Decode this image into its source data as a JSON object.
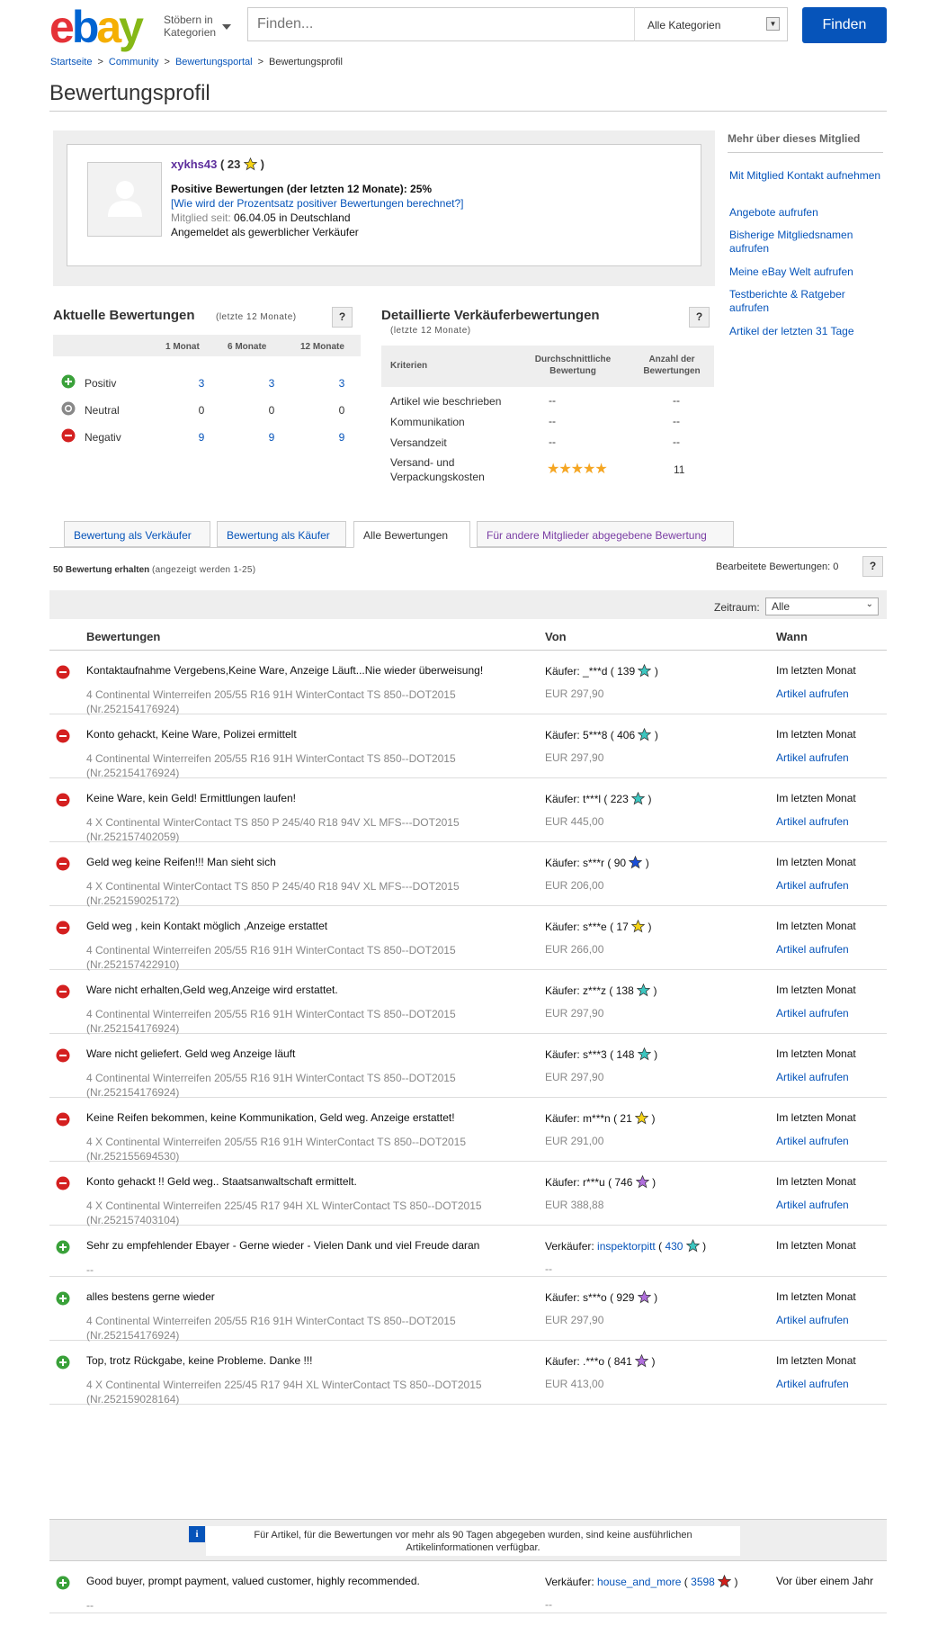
{
  "header": {
    "logo": [
      "e",
      "b",
      "a",
      "y"
    ],
    "browse_line1": "Stöbern in",
    "browse_line2": "Kategorien",
    "search_placeholder": "Finden...",
    "category": "Alle Kategorien",
    "find_button": "Finden"
  },
  "breadcrumb": [
    "Startseite",
    "Community",
    "Bewertungsportal",
    "Bewertungsprofil"
  ],
  "page_title": "Bewertungsprofil",
  "profile": {
    "username": "xykhs43",
    "score": "23",
    "positive": "Positive Bewertungen (der letzten 12 Monate): 25%",
    "how_calc": "[Wie wird der Prozentsatz positiver Bewertungen berechnet?]",
    "member_since_label": "Mitglied seit:",
    "member_since_date": "06.04.05",
    "member_since_country": "in Deutschland",
    "seller_type": "Angemeldet als gewerblicher Verkäufer"
  },
  "sidebar": {
    "heading": "Mehr über dieses Mitglied",
    "links": [
      "Mit Mitglied Kontakt aufnehmen",
      "Angebote aufrufen",
      "Bisherige Mitgliedsnamen aufrufen",
      "Meine eBay Welt aufrufen",
      "Testberichte & Ratgeber aufrufen",
      "Artikel der letzten 31 Tage"
    ]
  },
  "recent": {
    "title": "Aktuelle Bewertungen",
    "subtitle": "(letzte 12 Monate)",
    "help": "?",
    "cols": [
      "1 Monat",
      "6 Monate",
      "12 Monate"
    ],
    "rows": [
      {
        "label": "Positiv",
        "values": [
          "3",
          "3",
          "3"
        ]
      },
      {
        "label": "Neutral",
        "values": [
          "0",
          "0",
          "0"
        ]
      },
      {
        "label": "Negativ",
        "values": [
          "9",
          "9",
          "9"
        ]
      }
    ]
  },
  "dsr": {
    "title": "Detaillierte Verkäuferbewertungen",
    "subtitle": "(letzte 12 Monate)",
    "help": "?",
    "col_criteria": "Kriterien",
    "col_avg_1": "Durchschnittliche",
    "col_avg_2": "Bewertung",
    "col_count_1": "Anzahl der",
    "col_count_2": "Bewertungen",
    "rows": [
      {
        "label": "Artikel wie beschrieben",
        "avg": "--",
        "count": "--"
      },
      {
        "label": "Kommunikation",
        "avg": "--",
        "count": "--"
      },
      {
        "label": "Versandzeit",
        "avg": "--",
        "count": "--"
      },
      {
        "label": "Versand- und Verpackungskosten",
        "stars": 5,
        "count": "11"
      }
    ]
  },
  "tabs": [
    "Bewertung als Verkäufer",
    "Bewertung als Käufer",
    "Alle Bewertungen",
    "Für andere Mitglieder abgegebene Bewertung"
  ],
  "list_info": {
    "count_bold": "50 Bewertung erhalten",
    "count_rest": "(angezeigt werden 1-25)",
    "edited": "Bearbeitete Bewertungen: 0",
    "help": "?",
    "period_label": "Zeitraum:",
    "period_value": "Alle"
  },
  "columns": [
    "Bewertungen",
    "Von",
    "Wann"
  ],
  "colors": {
    "star_yellow": "#f5d316",
    "star_turquoise": "#3cc6c0",
    "star_blue": "#1b4fd8",
    "star_purple": "#b06fdc",
    "star_red": "#d4201b",
    "negative": "#d42020",
    "positive": "#3aa13a"
  },
  "feedback": [
    {
      "type": "negative",
      "comment": "Kontaktaufnahme Vergebens,Keine Ware, Anzeige Läuft...Nie wieder überweisung!",
      "item_line1": "4 Continental Winterreifen 205/55 R16 91H WinterContact TS 850--DOT2015",
      "item_line2": "(Nr.252154176924)",
      "from_role": "Käufer:",
      "from_name": "_***d",
      "from_score": "139",
      "star": "turquoise",
      "price": "EUR 297,90",
      "when": "Im letzten Monat",
      "view": "Artikel aufrufen"
    },
    {
      "type": "negative",
      "comment": "Konto gehackt, Keine Ware, Polizei ermittelt",
      "item_line1": "4 Continental Winterreifen 205/55 R16 91H WinterContact TS 850--DOT2015",
      "item_line2": "(Nr.252154176924)",
      "from_role": "Käufer:",
      "from_name": "5***8",
      "from_score": "406",
      "star": "turquoise",
      "price": "EUR 297,90",
      "when": "Im letzten Monat",
      "view": "Artikel aufrufen"
    },
    {
      "type": "negative",
      "comment": "Keine Ware, kein Geld! Ermittlungen laufen!",
      "item_line1": "4 X Continental WinterContact TS 850 P 245/40 R18 94V XL MFS---DOT2015",
      "item_line2": "(Nr.252157402059)",
      "from_role": "Käufer:",
      "from_name": "t***l",
      "from_score": "223",
      "star": "turquoise",
      "price": "EUR 445,00",
      "when": "Im letzten Monat",
      "view": "Artikel aufrufen"
    },
    {
      "type": "negative",
      "comment": "Geld weg keine Reifen!!! Man sieht sich",
      "item_line1": "4 X Continental WinterContact TS 850 P 245/40 R18 94V XL MFS---DOT2015",
      "item_line2": "(Nr.252159025172)",
      "from_role": "Käufer:",
      "from_name": "s***r",
      "from_score": "90",
      "star": "blue",
      "price": "EUR 206,00",
      "when": "Im letzten Monat",
      "view": "Artikel aufrufen"
    },
    {
      "type": "negative",
      "comment": "Geld weg , kein Kontakt möglich ,Anzeige erstattet",
      "item_line1": "4 Continental Winterreifen 205/55 R16 91H WinterContact TS 850--DOT2015",
      "item_line2": "(Nr.252157422910)",
      "from_role": "Käufer:",
      "from_name": "s***e",
      "from_score": "17",
      "star": "yellow",
      "price": "EUR 266,00",
      "when": "Im letzten Monat",
      "view": "Artikel aufrufen"
    },
    {
      "type": "negative",
      "comment": "Ware nicht erhalten,Geld weg,Anzeige wird erstattet.",
      "item_line1": "4 Continental Winterreifen 205/55 R16 91H WinterContact TS 850--DOT2015",
      "item_line2": "(Nr.252154176924)",
      "from_role": "Käufer:",
      "from_name": "z***z",
      "from_score": "138",
      "star": "turquoise",
      "price": "EUR 297,90",
      "when": "Im letzten Monat",
      "view": "Artikel aufrufen"
    },
    {
      "type": "negative",
      "comment": "Ware nicht geliefert. Geld weg Anzeige läuft",
      "item_line1": "4 Continental Winterreifen 205/55 R16 91H WinterContact TS 850--DOT2015",
      "item_line2": "(Nr.252154176924)",
      "from_role": "Käufer:",
      "from_name": "s***3",
      "from_score": "148",
      "star": "turquoise",
      "price": "EUR 297,90",
      "when": "Im letzten Monat",
      "view": "Artikel aufrufen"
    },
    {
      "type": "negative",
      "comment": "Keine Reifen bekommen, keine Kommunikation, Geld weg. Anzeige erstattet!",
      "item_line1": "4 X Continental Winterreifen 205/55 R16 91H WinterContact TS 850--DOT2015",
      "item_line2": "(Nr.252155694530)",
      "from_role": "Käufer:",
      "from_name": "m***n",
      "from_score": "21",
      "star": "yellow",
      "price": "EUR 291,00",
      "when": "Im letzten Monat",
      "view": "Artikel aufrufen"
    },
    {
      "type": "negative",
      "comment": "Konto gehackt !! Geld weg.. Staatsanwaltschaft ermittelt.",
      "item_line1": "4 X Continental Winterreifen 225/45 R17 94H XL WinterContact TS 850--DOT2015",
      "item_line2": "(Nr.252157403104)",
      "from_role": "Käufer:",
      "from_name": "r***u",
      "from_score": "746",
      "star": "purple",
      "price": "EUR 388,88",
      "when": "Im letzten Monat",
      "view": "Artikel aufrufen"
    },
    {
      "type": "positive",
      "comment": "Sehr zu empfehlender Ebayer - Gerne wieder - Vielen Dank und viel Freude daran",
      "item_line1": "--",
      "item_line2": "",
      "from_role": "Verkäufer:",
      "from_name": "inspektorpitt",
      "from_link": true,
      "from_score": "430",
      "star": "turquoise",
      "price": "--",
      "when": "Im letzten Monat",
      "view": ""
    },
    {
      "type": "positive",
      "comment": "alles bestens gerne wieder",
      "item_line1": "4 Continental Winterreifen 205/55 R16 91H WinterContact TS 850--DOT2015",
      "item_line2": "(Nr.252154176924)",
      "from_role": "Käufer:",
      "from_name": "s***o",
      "from_score": "929",
      "star": "purple",
      "price": "EUR 297,90",
      "when": "Im letzten Monat",
      "view": "Artikel aufrufen"
    },
    {
      "type": "positive",
      "comment": "Top, trotz Rückgabe, keine Probleme. Danke !!!",
      "item_line1": "4 X Continental Winterreifen 225/45 R17 94H XL WinterContact TS 850--DOT2015",
      "item_line2": "(Nr.252159028164)",
      "from_role": "Käufer:",
      "from_name": ".***o",
      "from_score": "841",
      "star": "purple",
      "price": "EUR 413,00",
      "when": "Im letzten Monat",
      "view": "Artikel aufrufen"
    }
  ],
  "notice": {
    "icon": "i",
    "line1": "Für Artikel, für die Bewertungen vor mehr als 90 Tagen abgegeben wurden, sind keine ausführlichen",
    "line2": "Artikelinformationen verfügbar."
  },
  "old_feedback": [
    {
      "type": "positive",
      "comment": "Good buyer, prompt payment, valued customer, highly recommended.",
      "item_line1": "--",
      "from_role": "Verkäufer:",
      "from_name": "house_and_more",
      "from_score": "3598",
      "star": "red",
      "price": "--",
      "when": "Vor über einem Jahr"
    }
  ]
}
